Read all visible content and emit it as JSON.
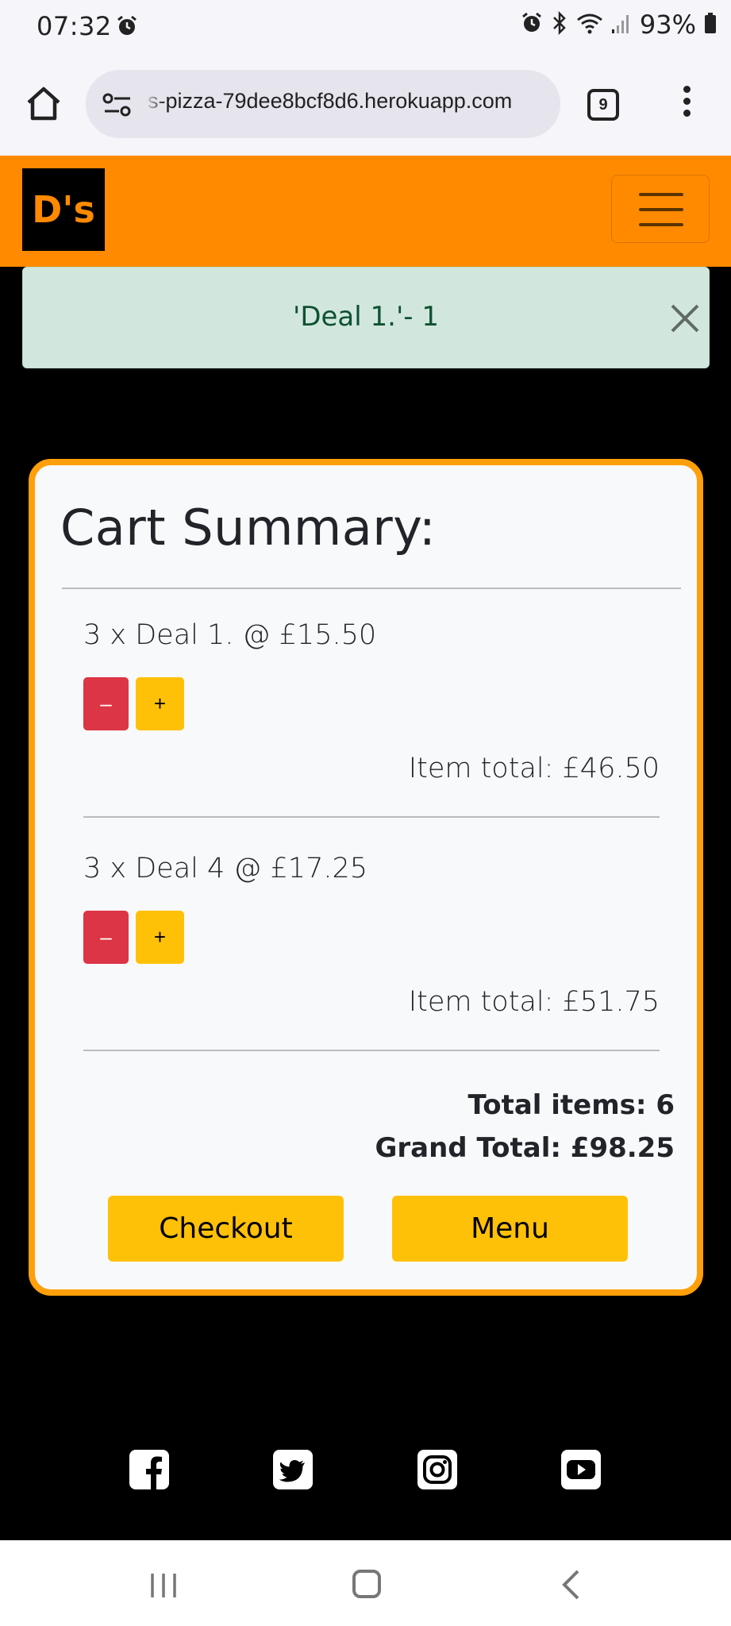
{
  "status_bar": {
    "time": "07:32",
    "battery": "93%"
  },
  "browser": {
    "url": "s-pizza-79dee8bcf8d6.herokuapp.com",
    "tab_count": "9"
  },
  "site": {
    "logo_text": "D's",
    "brand_color": "#ff8a00"
  },
  "alert": {
    "message": "'Deal 1.'- 1"
  },
  "cart": {
    "title": "Cart Summary:",
    "items": [
      {
        "line": "3 x Deal 1. @ £15.50",
        "minus_label": "–",
        "plus_label": "+",
        "item_total": "Item total: £46.50"
      },
      {
        "line": "3 x Deal 4 @ £17.25",
        "minus_label": "–",
        "plus_label": "+",
        "item_total": "Item total: £51.75"
      }
    ],
    "total_items": "Total items: 6",
    "grand_total": "Grand Total: £98.25",
    "checkout_label": "Checkout",
    "menu_label": "Menu"
  },
  "footer": {
    "social_icons": [
      "facebook-icon",
      "twitter-icon",
      "instagram-icon",
      "youtube-icon"
    ]
  }
}
